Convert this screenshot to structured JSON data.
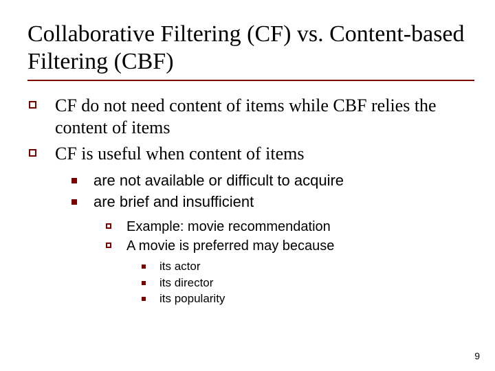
{
  "title": "Collaborative Filtering (CF) vs. Content-based Filtering (CBF)",
  "bullets": {
    "l1": [
      "CF do not need content of items while CBF relies the content of items",
      "CF is useful when content of items"
    ],
    "l2": [
      "are not available or difficult to acquire",
      "are brief and insufficient"
    ],
    "l3": [
      "Example: movie recommendation",
      "A movie is preferred may because"
    ],
    "l4": [
      "its actor",
      "its director",
      "its popularity"
    ]
  },
  "page_number": "9",
  "colors": {
    "accent": "#7a0000"
  }
}
